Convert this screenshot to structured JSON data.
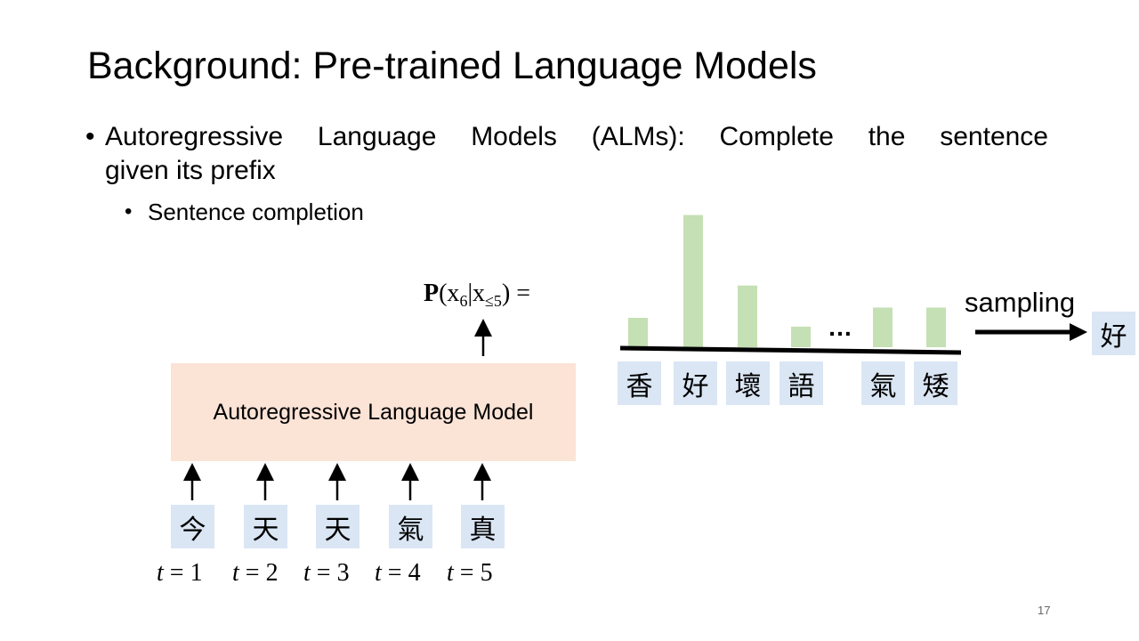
{
  "slide": {
    "title": "Background: Pre-trained Language Models",
    "bullet1_line1": "Autoregressive Language Models (ALMs): Complete the sentence",
    "bullet1_line2": "given its prefix",
    "bullet2": "Sentence completion",
    "bullet_glyph": "•",
    "page_number": "17"
  },
  "diagram": {
    "model_label": "Autoregressive Language Model",
    "input_tokens": [
      "今",
      "天",
      "天",
      "氣",
      "真"
    ],
    "time_labels": [
      {
        "var": "t",
        "rest": " = 1"
      },
      {
        "var": "t",
        "rest": " = 2"
      },
      {
        "var": "t",
        "rest": " = 3"
      },
      {
        "var": "t",
        "rest": " = 4"
      },
      {
        "var": "t",
        "rest": " = 5"
      }
    ],
    "probability": {
      "prefix": "P",
      "open": "(x",
      "sub1": "6",
      "mid": "|x",
      "sub2": "≤5",
      "close": ") ="
    },
    "ellipsis": "…",
    "sampling_label": "sampling",
    "sampled_token": "好",
    "colors": {
      "bar": "#c5e0b4",
      "token_bg": "#dae6f4",
      "model_bg": "#fbe3d6"
    }
  },
  "chart_data": {
    "type": "bar",
    "categories": [
      "香",
      "好",
      "壞",
      "語",
      "…",
      "氣",
      "矮"
    ],
    "values": [
      0.1,
      0.45,
      0.21,
      0.07,
      null,
      0.135,
      0.135
    ],
    "title": "",
    "xlabel": "",
    "ylabel": ""
  }
}
